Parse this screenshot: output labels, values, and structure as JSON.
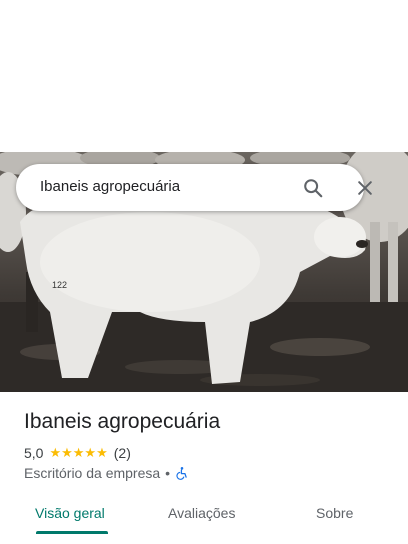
{
  "search": {
    "query": "Ibaneis agropecuária",
    "search_icon": "search-icon",
    "close_icon": "close-icon"
  },
  "place": {
    "name": "Ibaneis agropecuária",
    "rating": "5,0",
    "stars": "★★★★★",
    "review_count": "(2)",
    "category": "Escritório da empresa",
    "separator": "•",
    "accessibility_icon": "wheelchair-icon",
    "accessibility_color": "#1a73e8"
  },
  "tabs": [
    {
      "label": "Visão geral",
      "active": true
    },
    {
      "label": "Avaliações",
      "active": false
    },
    {
      "label": "Sobre",
      "active": false
    }
  ],
  "colors": {
    "accent": "#00796b",
    "star": "#fbbc04"
  }
}
